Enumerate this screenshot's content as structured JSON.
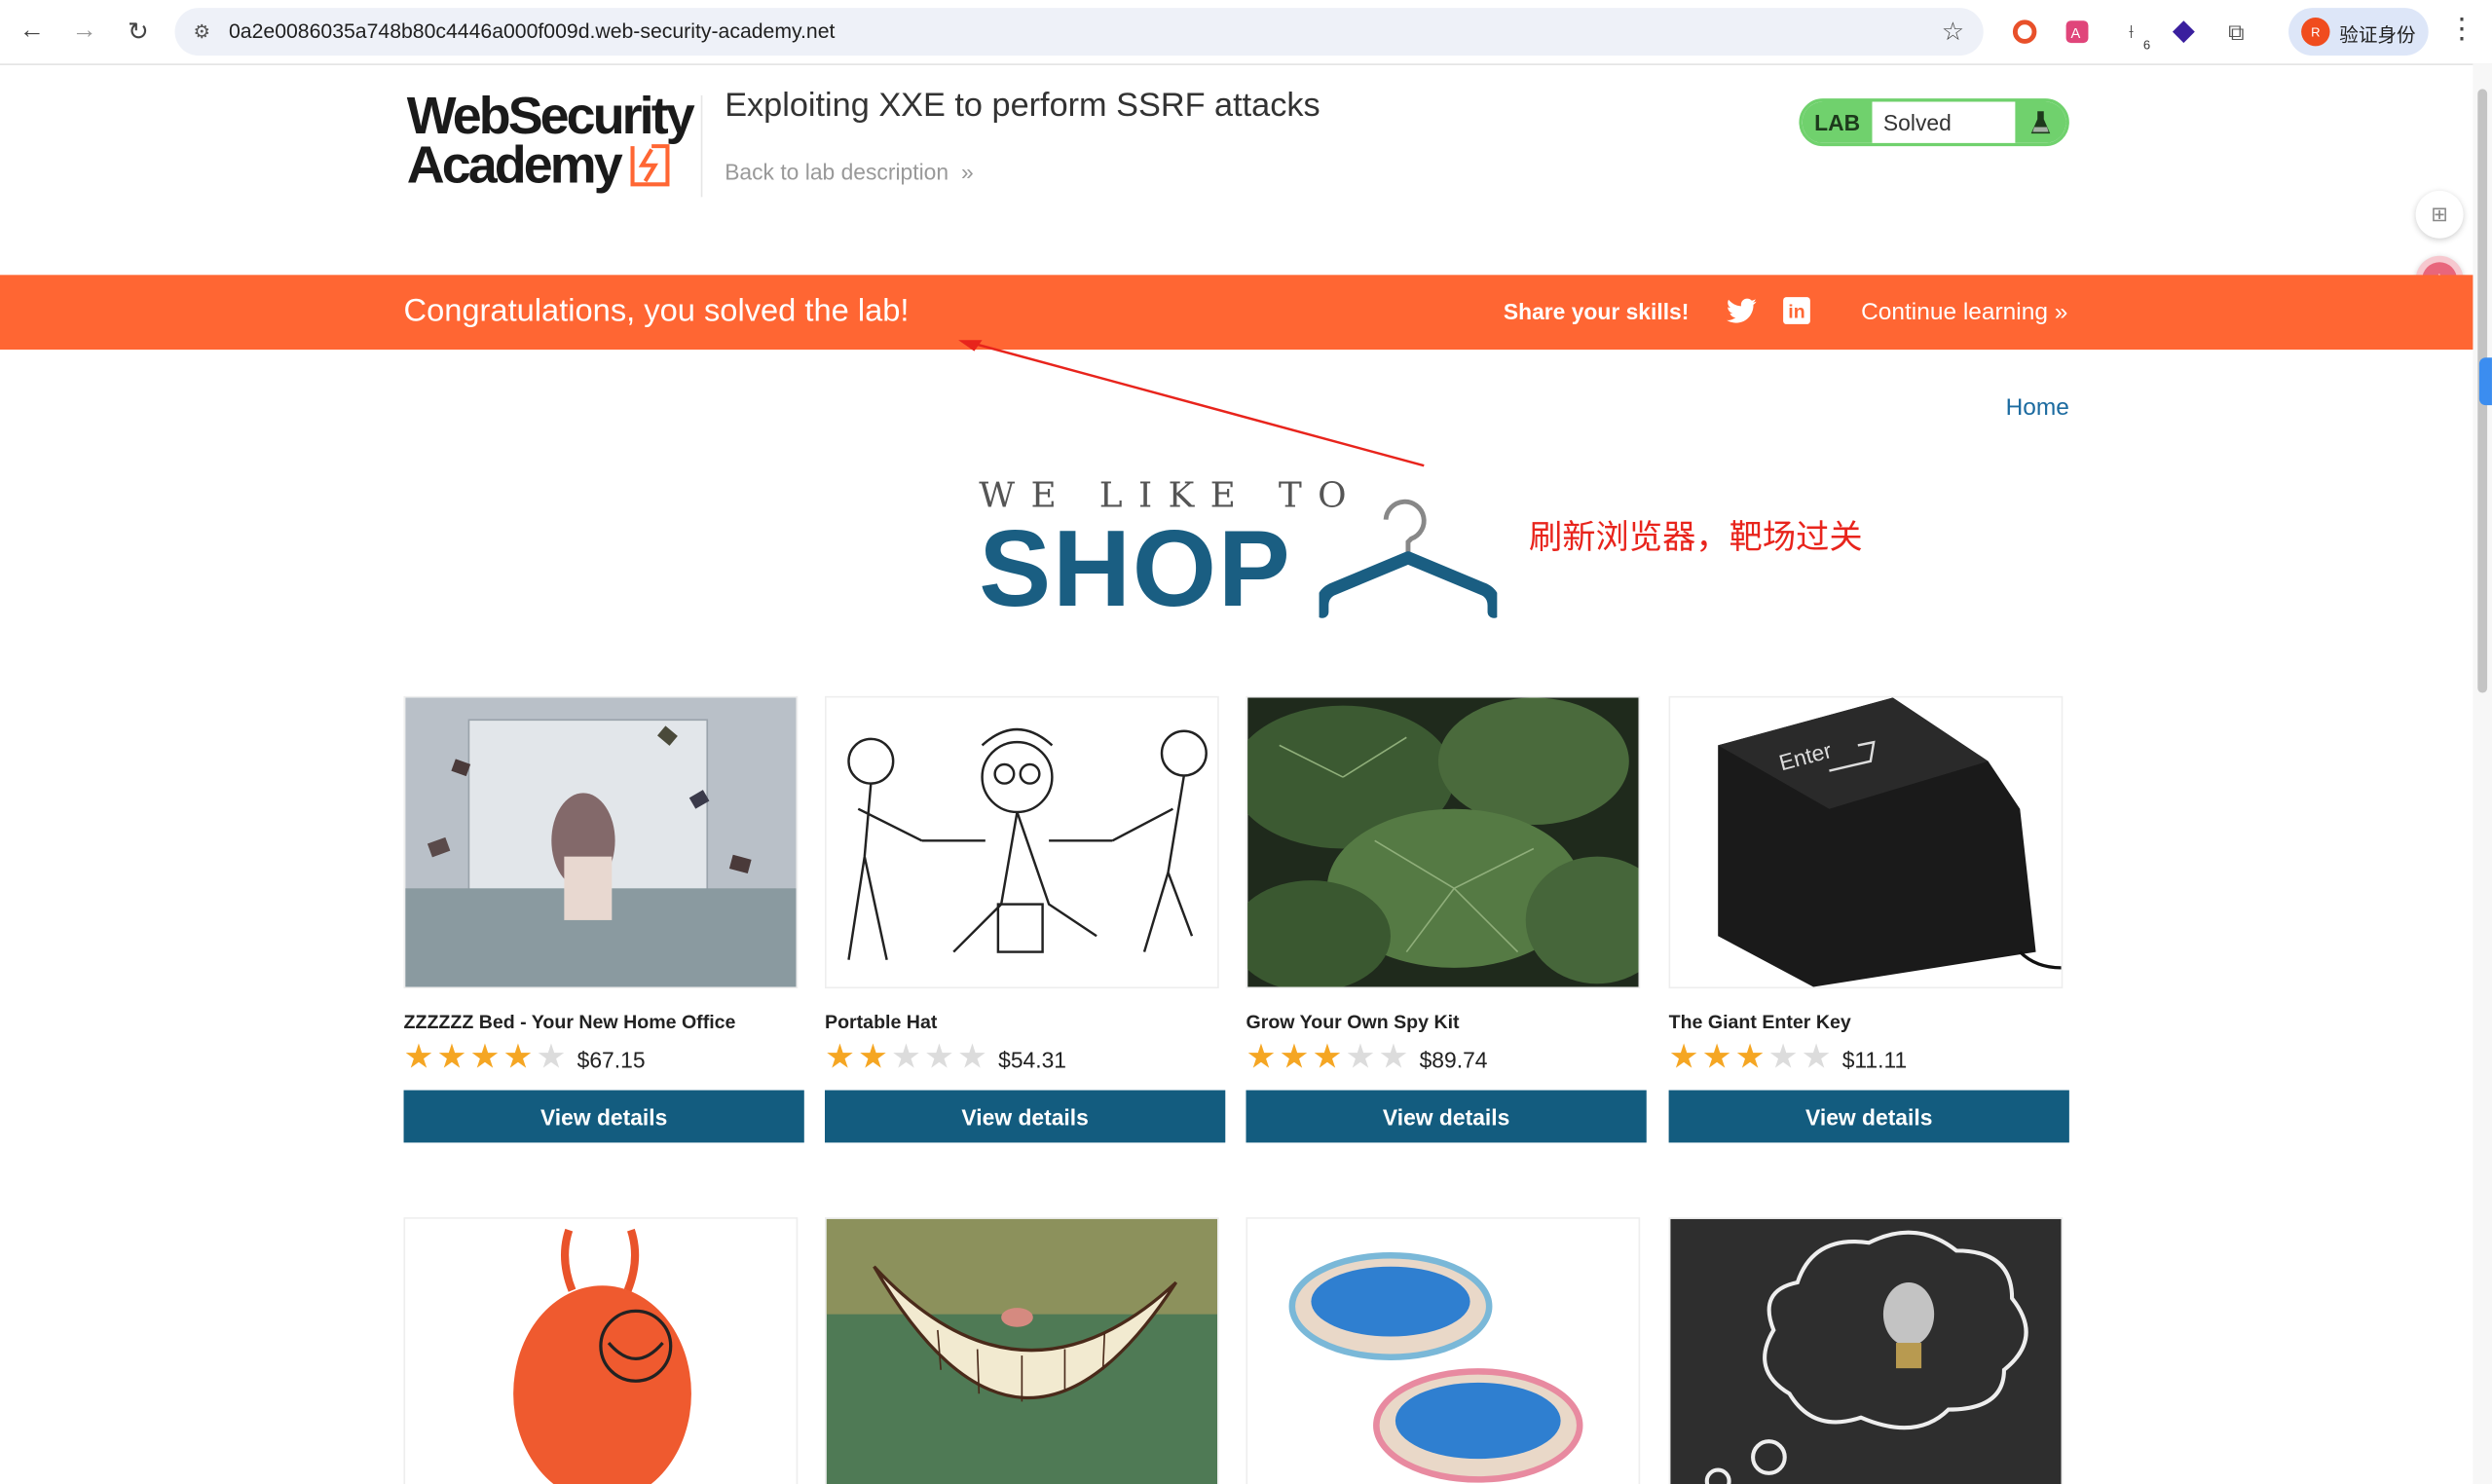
{
  "browser": {
    "url": "0a2e0086035a748b80c4446a000f009d.web-security-academy.net",
    "profile_label": "验证身份",
    "profile_avatar": "R",
    "ext_badge": "6"
  },
  "header": {
    "logo_line1": "WebSecurity",
    "logo_line2": "Academy",
    "lab_title": "Exploiting XXE to perform SSRF attacks",
    "back_link": "Back to lab description",
    "badge_lab": "LAB",
    "badge_status": "Solved"
  },
  "banner": {
    "congrats": "Congratulations, you solved the lab!",
    "share": "Share your skills!",
    "continue": "Continue learning"
  },
  "nav": {
    "home": "Home"
  },
  "shop_logo": {
    "line1": "WE LIKE TO",
    "line2": "SHOP"
  },
  "annotation": "刷新浏览器，靶场过关",
  "products": [
    {
      "name": "ZZZZZZ Bed - Your New Home Office",
      "rating": 4,
      "price": "$67.15",
      "button": "View details"
    },
    {
      "name": "Portable Hat",
      "rating": 2,
      "price": "$54.31",
      "button": "View details"
    },
    {
      "name": "Grow Your Own Spy Kit",
      "rating": 3,
      "price": "$89.74",
      "button": "View details"
    },
    {
      "name": "The Giant Enter Key",
      "rating": 3,
      "price": "$11.11",
      "button": "View details"
    }
  ],
  "colors": {
    "accent": "#ff6633",
    "button": "#135c7f",
    "badge_green": "#70d16d",
    "star": "#f5a623",
    "annotation": "#e8241c"
  },
  "icons": [
    "back-icon",
    "forward-icon",
    "reload-icon",
    "site-info-icon",
    "bookmark-star-icon",
    "twitter-icon",
    "linkedin-icon",
    "flask-icon",
    "hanger-icon"
  ]
}
